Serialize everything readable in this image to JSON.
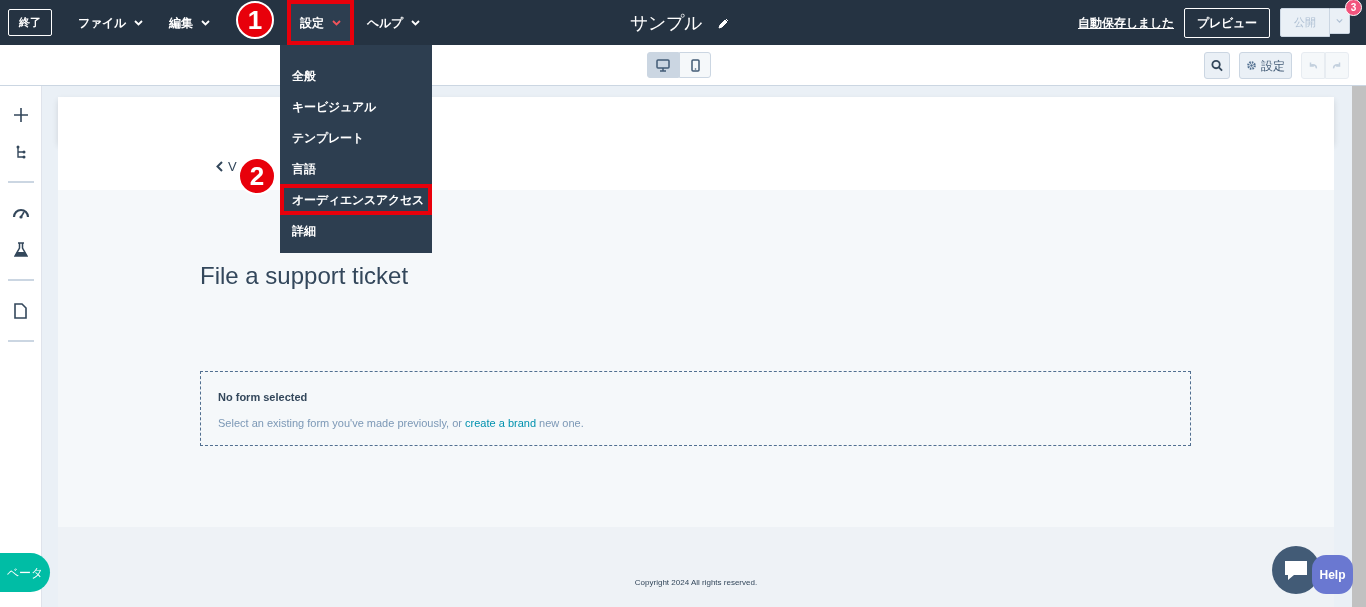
{
  "topbar": {
    "exit_button": "終了",
    "menus": [
      {
        "label": "ファイル",
        "expanded": false
      },
      {
        "label": "編集",
        "expanded": false
      },
      {
        "label": "設定",
        "expanded": true
      },
      {
        "label": "ヘルプ",
        "expanded": false
      }
    ],
    "title": "サンプル",
    "autosave": "自動保存しました",
    "preview_button": "プレビュー",
    "publish_button": {
      "label": "公開",
      "disabled": true,
      "badge": "3"
    }
  },
  "dropdown": {
    "items": [
      "全般",
      "キービジュアル",
      "テンプレート",
      "言語",
      "オーディエンスアクセス",
      "詳細"
    ]
  },
  "toolbar": {
    "devices": [
      {
        "kind": "desktop",
        "selected": true
      },
      {
        "kind": "mobile",
        "selected": false
      }
    ],
    "settings_button": "設定",
    "undo_disabled": true,
    "redo_disabled": true
  },
  "sidebar": {
    "items": [
      {
        "kind": "add"
      },
      {
        "kind": "tree"
      },
      {
        "kind": "divider"
      },
      {
        "kind": "gauge"
      },
      {
        "kind": "flask"
      },
      {
        "kind": "divider"
      },
      {
        "kind": "page"
      },
      {
        "kind": "divider"
      }
    ]
  },
  "page": {
    "back_link": "V",
    "heading": "File a support ticket",
    "form": {
      "title": "No form selected",
      "text_before": "Select an existing form you've made previously, or ",
      "link": "create a brand",
      "text_after": " new one."
    },
    "footer": "Copyright 2024 All rights reserved."
  },
  "beta_button": "ベータ",
  "help_button": "Help",
  "annotations": [
    {
      "kind": "marker",
      "label": "1"
    },
    {
      "kind": "box"
    },
    {
      "kind": "marker",
      "label": "2"
    },
    {
      "kind": "box"
    }
  ]
}
